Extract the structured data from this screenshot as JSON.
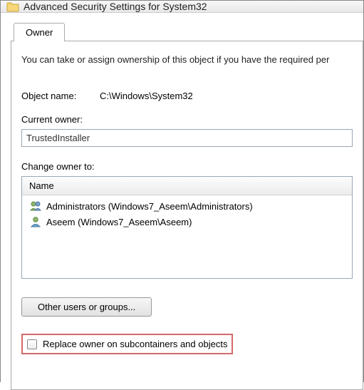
{
  "titlebar": {
    "title": "Advanced Security Settings for System32"
  },
  "tabs": {
    "owner": "Owner"
  },
  "panel": {
    "description": "You can take or assign ownership of this object if you have the required per",
    "object_name_label": "Object name:",
    "object_name_value": "C:\\Windows\\System32",
    "current_owner_label": "Current owner:",
    "current_owner_value": "TrustedInstaller",
    "change_owner_label": "Change owner to:",
    "list_header": "Name",
    "owners": [
      {
        "label": "Administrators (Windows7_Aseem\\Administrators)",
        "group": true
      },
      {
        "label": "Aseem (Windows7_Aseem\\Aseem)",
        "group": false
      }
    ],
    "other_button": "Other users or groups...",
    "replace_checkbox": "Replace owner on subcontainers and objects"
  }
}
